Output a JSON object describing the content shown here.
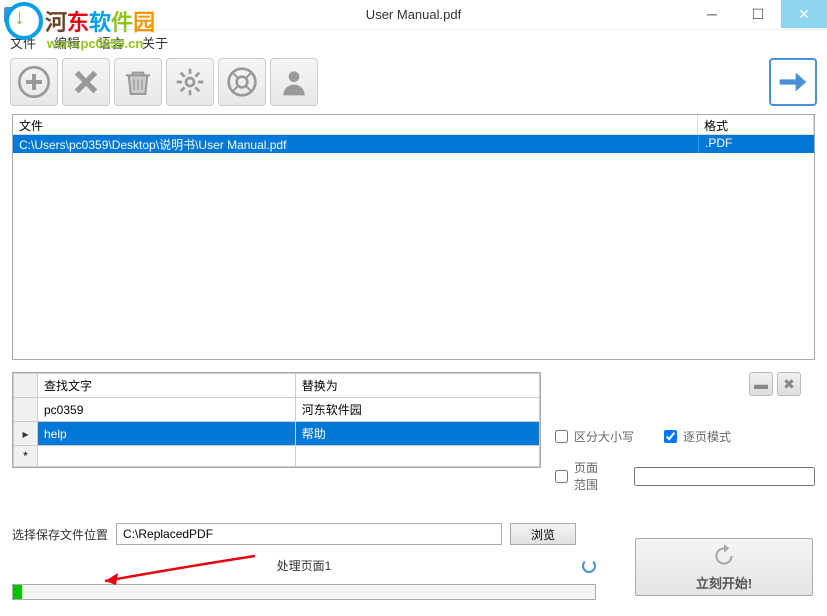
{
  "window": {
    "title": "User Manual.pdf"
  },
  "watermark": {
    "name": "河东软件园",
    "url": "www.pc0359.cn"
  },
  "menu": {
    "file": "文件",
    "edit": "编辑",
    "language": "语言",
    "about": "关于"
  },
  "filelist": {
    "headers": {
      "file": "文件",
      "format": "格式"
    },
    "rows": [
      {
        "file": "C:\\Users\\pc0359\\Desktop\\说明书\\User Manual.pdf",
        "format": ".PDF"
      }
    ]
  },
  "replace": {
    "headers": {
      "find": "查找文字",
      "replace": "替换为"
    },
    "rows": [
      {
        "find": "pc0359",
        "replace": "河东软件园",
        "selected": false,
        "marker": ""
      },
      {
        "find": "help",
        "replace": "帮助",
        "selected": true,
        "marker": "▸"
      },
      {
        "find": "",
        "replace": "",
        "selected": false,
        "marker": "*"
      }
    ]
  },
  "options": {
    "case_sensitive": {
      "label": "区分大小写",
      "checked": false
    },
    "page_mode": {
      "label": "逐页模式",
      "checked": true
    },
    "page_range": {
      "label": "页面范围",
      "checked": false,
      "value": ""
    }
  },
  "save": {
    "label": "选择保存文件位置",
    "path": "C:\\ReplacedPDF",
    "browse": "浏览"
  },
  "progress": {
    "label": "处理页面1",
    "percent": 1.5
  },
  "start": {
    "label": "立刻开始!"
  }
}
